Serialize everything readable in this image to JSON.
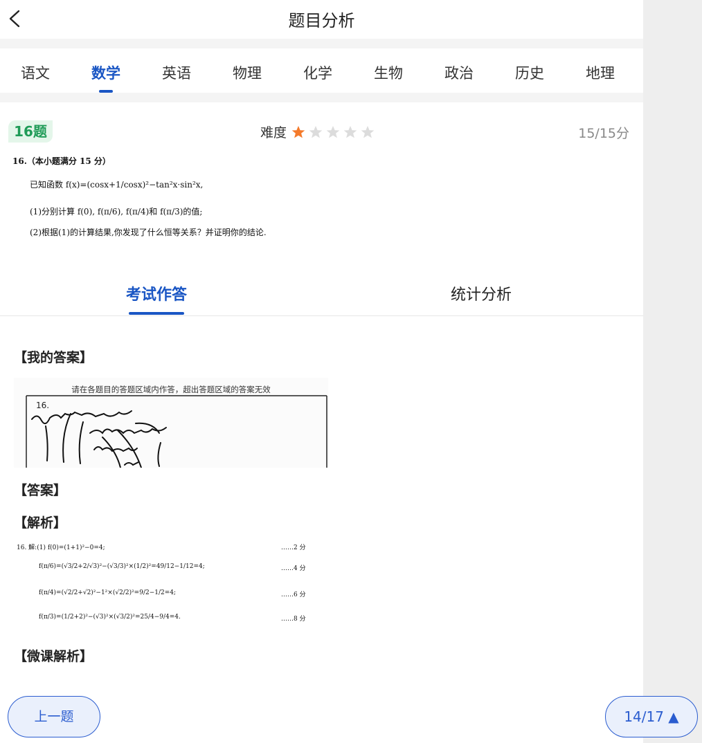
{
  "header": {
    "title": "题目分析"
  },
  "subjects": [
    "语文",
    "数学",
    "英语",
    "物理",
    "化学",
    "生物",
    "政治",
    "历史",
    "地理"
  ],
  "active_subject": "数学",
  "question": {
    "badge": "16题",
    "difficulty_label": "难度",
    "difficulty_stars": 1,
    "difficulty_max": 5,
    "score": "15/15分",
    "text": {
      "line1": "16.（本小题满分 15 分）",
      "line2": "已知函数 f(x)=(cosx+1/cosx)²−tan²x·sin²x,",
      "line3": "(1)分别计算 f(0), f(π/6), f(π/4)和 f(π/3)的值;",
      "line4": "(2)根据(1)的计算结果,你发现了什么恒等关系？并证明你的结论."
    }
  },
  "tabs": {
    "tab1": "考试作答",
    "tab2": "统计分析"
  },
  "sections": {
    "my_answer": "【我的答案】",
    "answer": "【答案】",
    "analysis": "【解析】",
    "micro": "【微课解析】"
  },
  "answer_sheet": {
    "notice": "请在各题目的答题区域内作答，超出答题区域的答案无效",
    "number": "16."
  },
  "analysis_lines": [
    {
      "text": "16. 解:(1) f(0)=(1+1)²−0=4;",
      "points": "……2 分"
    },
    {
      "text": "f(π/6)=(√3/2+2/√3)²−(√3/3)²×(1/2)²=49/12−1/12=4;",
      "points": "……4 分"
    },
    {
      "text": "f(π/4)=(√2/2+√2)²−1²×(√2/2)²=9/2−1/2=4;",
      "points": "……6 分"
    },
    {
      "text": "f(π/3)=(1/2+2)²−(√3)²×(√3/2)²=25/4−9/4=4.",
      "points": "……8 分"
    }
  ],
  "footer": {
    "prev": "上一题",
    "page": "14/17 ▲"
  },
  "colors": {
    "accent": "#1a56c4",
    "badge_bg": "#e4f6ea",
    "badge_text": "#1f9b57",
    "star_on": "#f47a2b",
    "star_off": "#dcdcdc"
  }
}
